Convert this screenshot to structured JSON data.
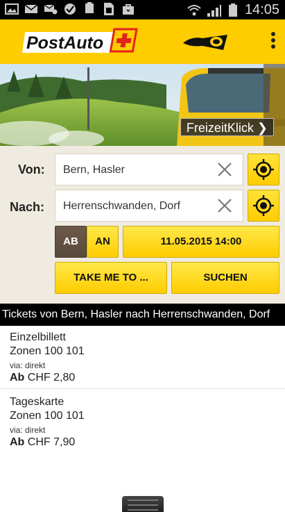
{
  "status_bar": {
    "time": "14:05",
    "battery_percent": "100%"
  },
  "app": {
    "brand": "PostAuto"
  },
  "banner": {
    "link_label": "FreizeitKlick",
    "chevron": "❯"
  },
  "form": {
    "from_label": "Von:",
    "from_value": "Bern, Hasler",
    "to_label": "Nach:",
    "to_value": "Herrenschwanden, Dorf",
    "ab_label": "AB",
    "an_label": "AN",
    "datetime": "11.05.2015 14:00",
    "take_me_label": "TAKE ME TO ...",
    "search_label": "SUCHEN"
  },
  "tickets": {
    "header": "Tickets von Bern, Hasler nach Herrenschwanden, Dorf",
    "items": [
      {
        "name": "Einzelbillett",
        "zones": "Zonen 100 101",
        "via": "via: direkt",
        "price_prefix": "Ab",
        "price": "CHF 2,80"
      },
      {
        "name": "Tageskarte",
        "zones": "Zonen 100 101",
        "via": "via: direkt",
        "price_prefix": "Ab",
        "price": "CHF 7,90"
      }
    ]
  },
  "colors": {
    "brand_yellow": "#ffcc00",
    "brand_red": "#e2231a",
    "selected_brown": "#5f4f41"
  }
}
